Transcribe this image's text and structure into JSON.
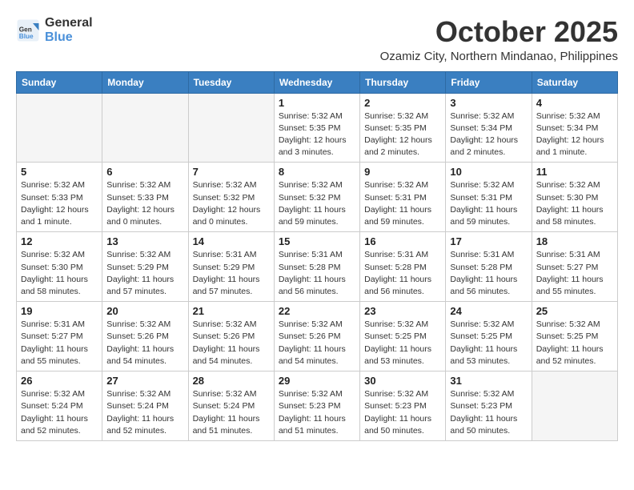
{
  "logo": {
    "line1": "General",
    "line2": "Blue"
  },
  "title": "October 2025",
  "subtitle": "Ozamiz City, Northern Mindanao, Philippines",
  "days_of_week": [
    "Sunday",
    "Monday",
    "Tuesday",
    "Wednesday",
    "Thursday",
    "Friday",
    "Saturday"
  ],
  "weeks": [
    [
      {
        "num": "",
        "info": ""
      },
      {
        "num": "",
        "info": ""
      },
      {
        "num": "",
        "info": ""
      },
      {
        "num": "1",
        "info": "Sunrise: 5:32 AM\nSunset: 5:35 PM\nDaylight: 12 hours\nand 3 minutes."
      },
      {
        "num": "2",
        "info": "Sunrise: 5:32 AM\nSunset: 5:35 PM\nDaylight: 12 hours\nand 2 minutes."
      },
      {
        "num": "3",
        "info": "Sunrise: 5:32 AM\nSunset: 5:34 PM\nDaylight: 12 hours\nand 2 minutes."
      },
      {
        "num": "4",
        "info": "Sunrise: 5:32 AM\nSunset: 5:34 PM\nDaylight: 12 hours\nand 1 minute."
      }
    ],
    [
      {
        "num": "5",
        "info": "Sunrise: 5:32 AM\nSunset: 5:33 PM\nDaylight: 12 hours\nand 1 minute."
      },
      {
        "num": "6",
        "info": "Sunrise: 5:32 AM\nSunset: 5:33 PM\nDaylight: 12 hours\nand 0 minutes."
      },
      {
        "num": "7",
        "info": "Sunrise: 5:32 AM\nSunset: 5:32 PM\nDaylight: 12 hours\nand 0 minutes."
      },
      {
        "num": "8",
        "info": "Sunrise: 5:32 AM\nSunset: 5:32 PM\nDaylight: 11 hours\nand 59 minutes."
      },
      {
        "num": "9",
        "info": "Sunrise: 5:32 AM\nSunset: 5:31 PM\nDaylight: 11 hours\nand 59 minutes."
      },
      {
        "num": "10",
        "info": "Sunrise: 5:32 AM\nSunset: 5:31 PM\nDaylight: 11 hours\nand 59 minutes."
      },
      {
        "num": "11",
        "info": "Sunrise: 5:32 AM\nSunset: 5:30 PM\nDaylight: 11 hours\nand 58 minutes."
      }
    ],
    [
      {
        "num": "12",
        "info": "Sunrise: 5:32 AM\nSunset: 5:30 PM\nDaylight: 11 hours\nand 58 minutes."
      },
      {
        "num": "13",
        "info": "Sunrise: 5:32 AM\nSunset: 5:29 PM\nDaylight: 11 hours\nand 57 minutes."
      },
      {
        "num": "14",
        "info": "Sunrise: 5:31 AM\nSunset: 5:29 PM\nDaylight: 11 hours\nand 57 minutes."
      },
      {
        "num": "15",
        "info": "Sunrise: 5:31 AM\nSunset: 5:28 PM\nDaylight: 11 hours\nand 56 minutes."
      },
      {
        "num": "16",
        "info": "Sunrise: 5:31 AM\nSunset: 5:28 PM\nDaylight: 11 hours\nand 56 minutes."
      },
      {
        "num": "17",
        "info": "Sunrise: 5:31 AM\nSunset: 5:28 PM\nDaylight: 11 hours\nand 56 minutes."
      },
      {
        "num": "18",
        "info": "Sunrise: 5:31 AM\nSunset: 5:27 PM\nDaylight: 11 hours\nand 55 minutes."
      }
    ],
    [
      {
        "num": "19",
        "info": "Sunrise: 5:31 AM\nSunset: 5:27 PM\nDaylight: 11 hours\nand 55 minutes."
      },
      {
        "num": "20",
        "info": "Sunrise: 5:32 AM\nSunset: 5:26 PM\nDaylight: 11 hours\nand 54 minutes."
      },
      {
        "num": "21",
        "info": "Sunrise: 5:32 AM\nSunset: 5:26 PM\nDaylight: 11 hours\nand 54 minutes."
      },
      {
        "num": "22",
        "info": "Sunrise: 5:32 AM\nSunset: 5:26 PM\nDaylight: 11 hours\nand 54 minutes."
      },
      {
        "num": "23",
        "info": "Sunrise: 5:32 AM\nSunset: 5:25 PM\nDaylight: 11 hours\nand 53 minutes."
      },
      {
        "num": "24",
        "info": "Sunrise: 5:32 AM\nSunset: 5:25 PM\nDaylight: 11 hours\nand 53 minutes."
      },
      {
        "num": "25",
        "info": "Sunrise: 5:32 AM\nSunset: 5:25 PM\nDaylight: 11 hours\nand 52 minutes."
      }
    ],
    [
      {
        "num": "26",
        "info": "Sunrise: 5:32 AM\nSunset: 5:24 PM\nDaylight: 11 hours\nand 52 minutes."
      },
      {
        "num": "27",
        "info": "Sunrise: 5:32 AM\nSunset: 5:24 PM\nDaylight: 11 hours\nand 52 minutes."
      },
      {
        "num": "28",
        "info": "Sunrise: 5:32 AM\nSunset: 5:24 PM\nDaylight: 11 hours\nand 51 minutes."
      },
      {
        "num": "29",
        "info": "Sunrise: 5:32 AM\nSunset: 5:23 PM\nDaylight: 11 hours\nand 51 minutes."
      },
      {
        "num": "30",
        "info": "Sunrise: 5:32 AM\nSunset: 5:23 PM\nDaylight: 11 hours\nand 50 minutes."
      },
      {
        "num": "31",
        "info": "Sunrise: 5:32 AM\nSunset: 5:23 PM\nDaylight: 11 hours\nand 50 minutes."
      },
      {
        "num": "",
        "info": ""
      }
    ]
  ]
}
